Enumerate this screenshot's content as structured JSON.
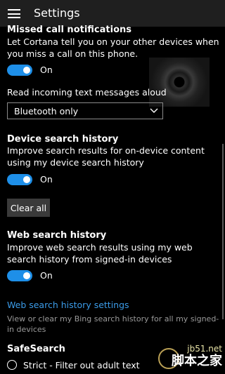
{
  "header": {
    "title": "Settings"
  },
  "missed_calls": {
    "heading": "Missed call notifications",
    "description": "Let Cortana tell you on your other devices when you miss a call on this phone.",
    "toggle_state": "On"
  },
  "read_messages": {
    "label": "Read incoming text messages aloud",
    "selected": "Bluetooth only"
  },
  "device_search": {
    "heading": "Device search history",
    "description": "Improve search results for on-device content using my device search history",
    "toggle_state": "On",
    "clear_button": "Clear all"
  },
  "web_search": {
    "heading": "Web search history",
    "description": "Improve web search results using my web search history from signed-in devices",
    "toggle_state": "On",
    "settings_link": "Web search history settings",
    "link_caption": "View or clear my Bing search history for all my signed-in devices"
  },
  "safe_search": {
    "heading": "SafeSearch",
    "option_strict": "Strict - Filter out adult text"
  },
  "watermark": {
    "site": "jb51.net",
    "text": "脚本之家"
  }
}
